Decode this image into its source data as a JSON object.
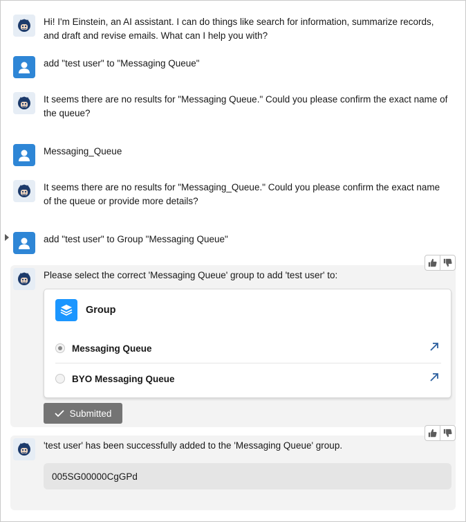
{
  "messages": [
    {
      "role": "bot",
      "text": "Hi! I'm Einstein, an AI assistant. I can do things like search for information, summarize records, and draft and revise emails. What can I help you with?"
    },
    {
      "role": "user",
      "text": "add \"test user\" to \"Messaging Queue\""
    },
    {
      "role": "bot",
      "text": "It seems there are no results for \"Messaging Queue.\" Could you please confirm the exact name of the queue?"
    },
    {
      "role": "user",
      "text": "Messaging_Queue"
    },
    {
      "role": "bot",
      "text": "It seems there are no results for \"Messaging_Queue.\" Could you please confirm the exact name of the queue or provide more details?"
    },
    {
      "role": "user",
      "text": "add \"test user\" to Group \"Messaging Queue\""
    },
    {
      "role": "bot",
      "text": "Please select the correct 'Messaging Queue' group to add 'test user' to:"
    },
    {
      "role": "bot",
      "text": "'test user' has been successfully added to the 'Messaging Queue' group."
    }
  ],
  "group_card": {
    "title": "Group",
    "options": [
      {
        "label": "Messaging Queue",
        "selected": true
      },
      {
        "label": "BYO Messaging Queue",
        "selected": false
      }
    ]
  },
  "submitted_label": "Submitted",
  "record_id": "005SG00000CgGPd",
  "icons": {
    "bot": "einstein-avatar-icon",
    "user": "user-avatar-icon",
    "like": "thumbs-up-icon",
    "dislike": "thumbs-down-icon",
    "group": "group-stack-icon",
    "open": "open-record-arrow-icon",
    "check": "check-icon"
  },
  "colors": {
    "user_avatar": "#2e86d6",
    "group_tile": "#1b96ff",
    "link": "#2b5f9e",
    "submitted_button": "#747474"
  }
}
